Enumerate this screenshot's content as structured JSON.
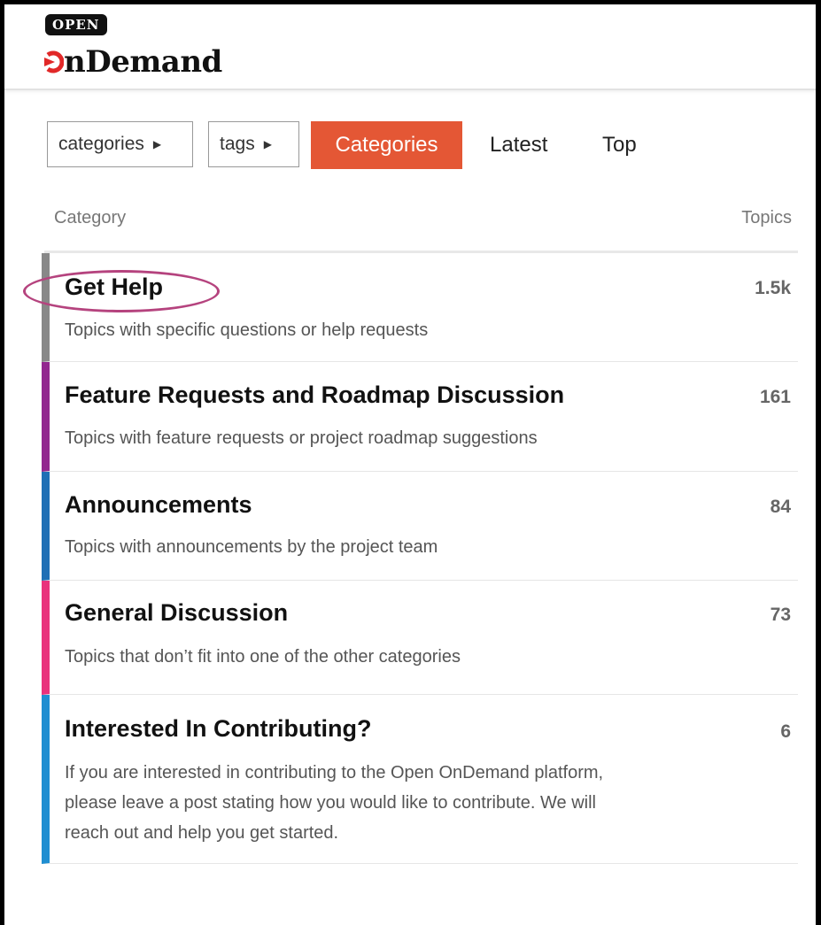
{
  "logo": {
    "top_text": "OPEN",
    "main_text": "nDemand",
    "mark_icon": "ondemand-o-arrow-icon",
    "brand_color": "#e12828"
  },
  "nav": {
    "categories_dropdown": "categories",
    "tags_dropdown": "tags",
    "caret_icon": "caret-right-icon",
    "active_tab": "Categories",
    "latest_tab": "Latest",
    "top_tab": "Top",
    "accent_color": "#e45735"
  },
  "table": {
    "col_category": "Category",
    "col_topics": "Topics"
  },
  "categories": [
    {
      "name": "Get Help",
      "desc": "Topics with specific questions or help requests",
      "count": "1.5k",
      "color": "#888888"
    },
    {
      "name": "Feature Requests and Roadmap Discussion",
      "desc": "Topics with feature requests or project roadmap suggestions",
      "count": "161",
      "color": "#92278f"
    },
    {
      "name": "Announcements",
      "desc": "Topics with announcements by the project team",
      "count": "84",
      "color": "#1f6fb5"
    },
    {
      "name": "General Discussion",
      "desc": "Topics that don’t fit into one of the other categories",
      "count": "73",
      "color": "#e9327c"
    },
    {
      "name": "Interested In Contributing?",
      "desc": "If you are interested in contributing to the Open OnDemand platform, please leave a post stating how you would like to contribute. We will reach out and help you get started.",
      "count": "6",
      "color": "#1f8ed1"
    }
  ],
  "highlight_color": "#b5437e"
}
